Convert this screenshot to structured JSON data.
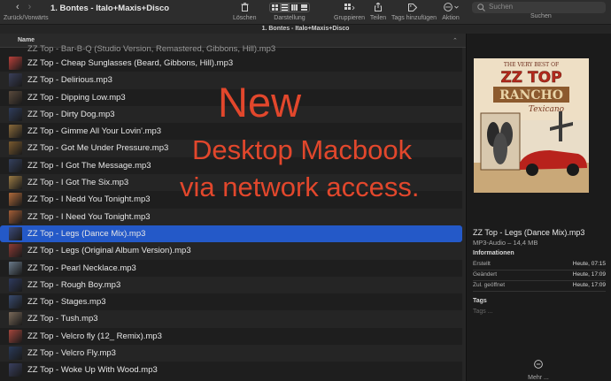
{
  "toolbar": {
    "nav_label": "Zurück/Vorwärts",
    "title": "1. Bontes - Italo+Maxis+Disco",
    "tools": [
      {
        "label": "Löschen"
      },
      {
        "label": "Darstellung"
      },
      {
        "label": "Gruppieren"
      },
      {
        "label": "Teilen"
      },
      {
        "label": "Tags hinzufügen"
      },
      {
        "label": "Aktion"
      }
    ],
    "search_placeholder": "Suchen",
    "search_label": "Suchen"
  },
  "tab_title": "1. Bontes - Italo+Maxis+Disco",
  "list": {
    "column_name": "Name",
    "partial_row": "ZZ Top - Bar-B-Q (Studio Version, Remastered, Gibbons, Hill).mp3",
    "rows": [
      {
        "name": "ZZ Top - Cheap Sunglasses (Beard, Gibbons, Hill).mp3",
        "thumb": "#b9403a"
      },
      {
        "name": "ZZ Top - Delirious.mp3",
        "thumb": "#3a3f5a"
      },
      {
        "name": "ZZ Top - Dipping Low.mp3",
        "thumb": "#5a4a3c"
      },
      {
        "name": "ZZ Top - Dirty Dog.mp3",
        "thumb": "#2f3d5c"
      },
      {
        "name": "ZZ Top - Gimme All Your Lovin'.mp3",
        "thumb": "#8a6a3a"
      },
      {
        "name": "ZZ Top - Got Me Under Pressure.mp3",
        "thumb": "#7a5a2e"
      },
      {
        "name": "ZZ Top - I Got The Message.mp3",
        "thumb": "#34405e"
      },
      {
        "name": "ZZ Top - I Got The Six.mp3",
        "thumb": "#9a7a44"
      },
      {
        "name": "ZZ Top - I Nedd You Tonight.mp3",
        "thumb": "#b06a3a"
      },
      {
        "name": "ZZ Top - I Need You Tonight.mp3",
        "thumb": "#a35e36"
      },
      {
        "name": "ZZ Top - Legs (Dance Mix).mp3",
        "thumb": "#3b4a7a"
      },
      {
        "name": "ZZ Top - Legs (Original Album Version).mp3",
        "thumb": "#8c3a34"
      },
      {
        "name": "ZZ Top - Pearl Necklace.mp3",
        "thumb": "#6a7a8a"
      },
      {
        "name": "ZZ Top - Rough Boy.mp3",
        "thumb": "#2e3a5e"
      },
      {
        "name": "ZZ Top - Stages.mp3",
        "thumb": "#384a6e"
      },
      {
        "name": "ZZ Top - Tush.mp3",
        "thumb": "#7a6a5a"
      },
      {
        "name": "ZZ Top - Velcro fly (12_ Remix).mp3",
        "thumb": "#a4463c"
      },
      {
        "name": "ZZ Top - Velcro Fly.mp3",
        "thumb": "#2a3a5a"
      },
      {
        "name": "ZZ Top - Woke Up With Wood.mp3",
        "thumb": "#3a4060"
      }
    ],
    "selected_name": "ZZ Top - Legs (Dance Mix).mp3"
  },
  "overlay": {
    "line1": "New",
    "line2": "Desktop Macbook",
    "line3": "via network access."
  },
  "preview": {
    "cover_text": {
      "top": "THE VERY BEST OF",
      "band": "ZZ TOP",
      "title": "RANCHO",
      "title2": "Texicano"
    },
    "file_name": "ZZ Top - Legs (Dance Mix).mp3",
    "file_meta": "MP3-Audio – 14,4 MB",
    "info_heading": "Informationen",
    "info": [
      {
        "key": "Erstellt",
        "value": "Heute, 07:15"
      },
      {
        "key": "Geändert",
        "value": "Heute, 17:09"
      },
      {
        "key": "Zul. geöffnet",
        "value": "Heute, 17:09"
      }
    ],
    "tags_heading": "Tags",
    "tags_placeholder": "Tags ...",
    "more_label": "Mehr ..."
  },
  "colors": {
    "accent": "#2459c8",
    "overlay": "#e2472c",
    "background": "#1e1e1e"
  }
}
